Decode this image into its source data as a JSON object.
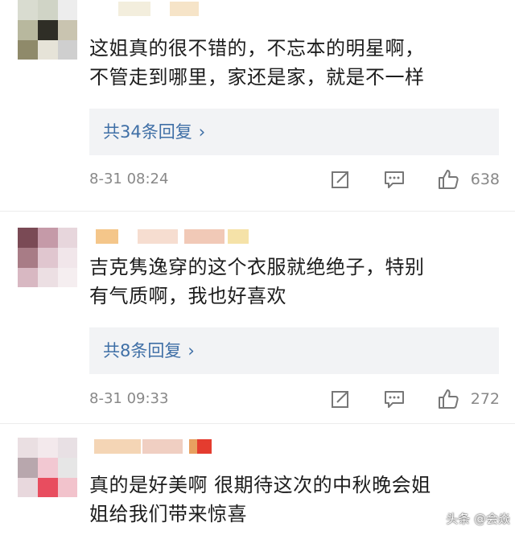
{
  "comments": [
    {
      "text_lines": [
        "这姐真的很不错的，不忘本的明星啊，",
        "不管走到哪里，家还是家，就是不一样"
      ],
      "replies_label": "共34条回复",
      "date": "8-31 08:24",
      "likes": "638",
      "avatar_colors": [
        "#d9dcd0",
        "#d0d4c6",
        "#ededed",
        "#b8b89e",
        "#2f2e26",
        "#c9c4b0",
        "#8f8a6a",
        "#e6e3d8",
        "#cfcfcf"
      ],
      "name_colors": [
        "#f3eedd",
        "#f6e4c8"
      ]
    },
    {
      "text_lines": [
        "吉克隽逸穿的这个衣服就绝绝子，特别",
        "有气质啊，我也好喜欢"
      ],
      "replies_label": "共8条回复",
      "date": "8-31 09:33",
      "likes": "272",
      "avatar_colors": [
        "#7a4a55",
        "#c59aa8",
        "#e7d6dc",
        "#a87c86",
        "#e0c6cf",
        "#f1e6ea",
        "#d8b8c2",
        "#ecdfe3",
        "#f5eef0"
      ],
      "name_colors": [
        "#f4c68a",
        "#f6ddd0",
        "#f1c9b7",
        "#f5e2a8"
      ]
    },
    {
      "text_lines": [
        "真的是好美啊 很期待这次的中秋晚会姐",
        "姐给我们带来惊喜"
      ],
      "avatar_colors": [
        "#eadfe2",
        "#f3e9ec",
        "#e8e0e4",
        "#b8a7ad",
        "#f2c8d2",
        "#e6e6e6",
        "#e8d8dd",
        "#e84d5f",
        "#f2c3cc"
      ],
      "name_colors": [
        "#f4d5b5",
        "#f0cfc2",
        "#e8a060",
        "#e43c2f"
      ]
    }
  ],
  "watermark": "头条 @会焱"
}
